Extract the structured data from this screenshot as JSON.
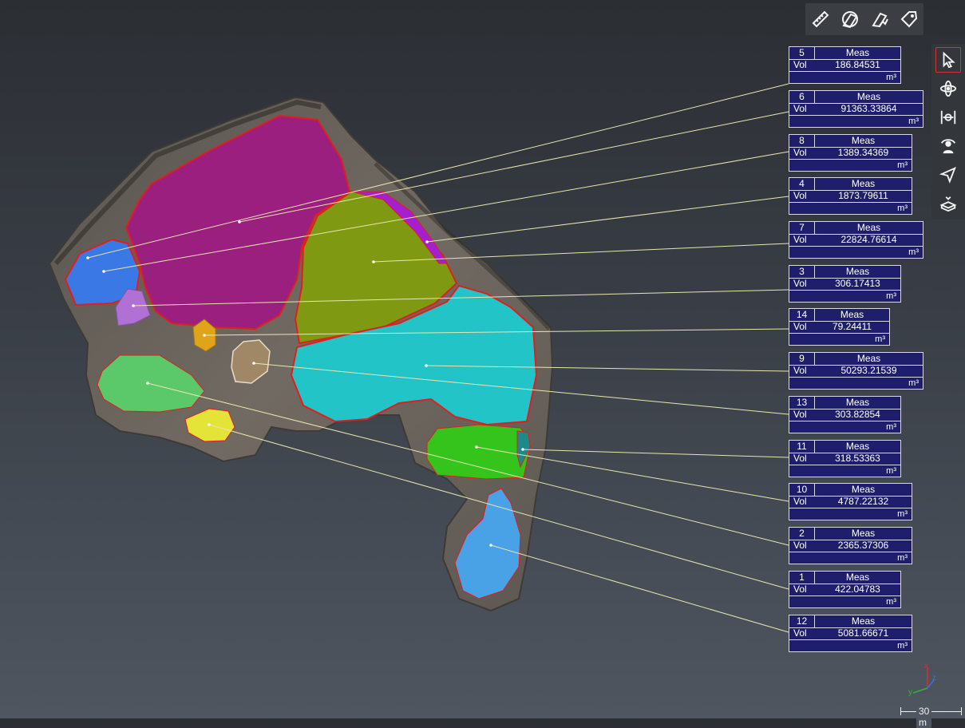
{
  "top_toolbar": {
    "tools": [
      {
        "name": "ruler-icon"
      },
      {
        "name": "volume-measure-icon"
      },
      {
        "name": "profile-measure-icon"
      },
      {
        "name": "tag-icon"
      }
    ]
  },
  "side_toolbar": {
    "tools": [
      {
        "name": "select-pointer-icon",
        "active": true
      },
      {
        "name": "orbit-icon",
        "active": false
      },
      {
        "name": "pan-fit-icon",
        "active": false
      },
      {
        "name": "walk-person-icon",
        "active": false
      },
      {
        "name": "fly-icon",
        "active": false
      },
      {
        "name": "eraser-icon",
        "active": false
      }
    ]
  },
  "labels_common": {
    "type": "Meas",
    "vol_label": "Vol",
    "unit": "m³"
  },
  "measurements": [
    {
      "id": "5",
      "value": "186.84531"
    },
    {
      "id": "6",
      "value": "91363.33864"
    },
    {
      "id": "8",
      "value": "1389.34369"
    },
    {
      "id": "4",
      "value": "1873.79611"
    },
    {
      "id": "7",
      "value": "22824.76614"
    },
    {
      "id": "3",
      "value": "306.17413"
    },
    {
      "id": "14",
      "value": "79.24411"
    },
    {
      "id": "9",
      "value": "50293.21539"
    },
    {
      "id": "13",
      "value": "303.82854"
    },
    {
      "id": "11",
      "value": "318.53363"
    },
    {
      "id": "10",
      "value": "4787.22132"
    },
    {
      "id": "2",
      "value": "2365.37306"
    },
    {
      "id": "1",
      "value": "422.04783"
    },
    {
      "id": "12",
      "value": "5081.66671"
    }
  ],
  "scale_bar": {
    "label": "30 m"
  },
  "axes": {
    "x": "x",
    "y": "y",
    "z": "z"
  },
  "colors": {
    "label_bg": "#1e1e6c",
    "leader_line": "#e8e6b0",
    "active_tool_border": "#d2323c",
    "region_purple": "#9a1f7e",
    "region_olive": "#7f9a12",
    "region_cyan": "#22c4c8",
    "region_green": "#34c41c",
    "region_light_green": "#5bc86a",
    "region_blue": "#3a78e6",
    "region_sky": "#4aa2e6",
    "region_yellow": "#e4e438",
    "region_orange": "#e0a41a",
    "region_tan": "#a08866",
    "region_lilac": "#b070d4"
  }
}
